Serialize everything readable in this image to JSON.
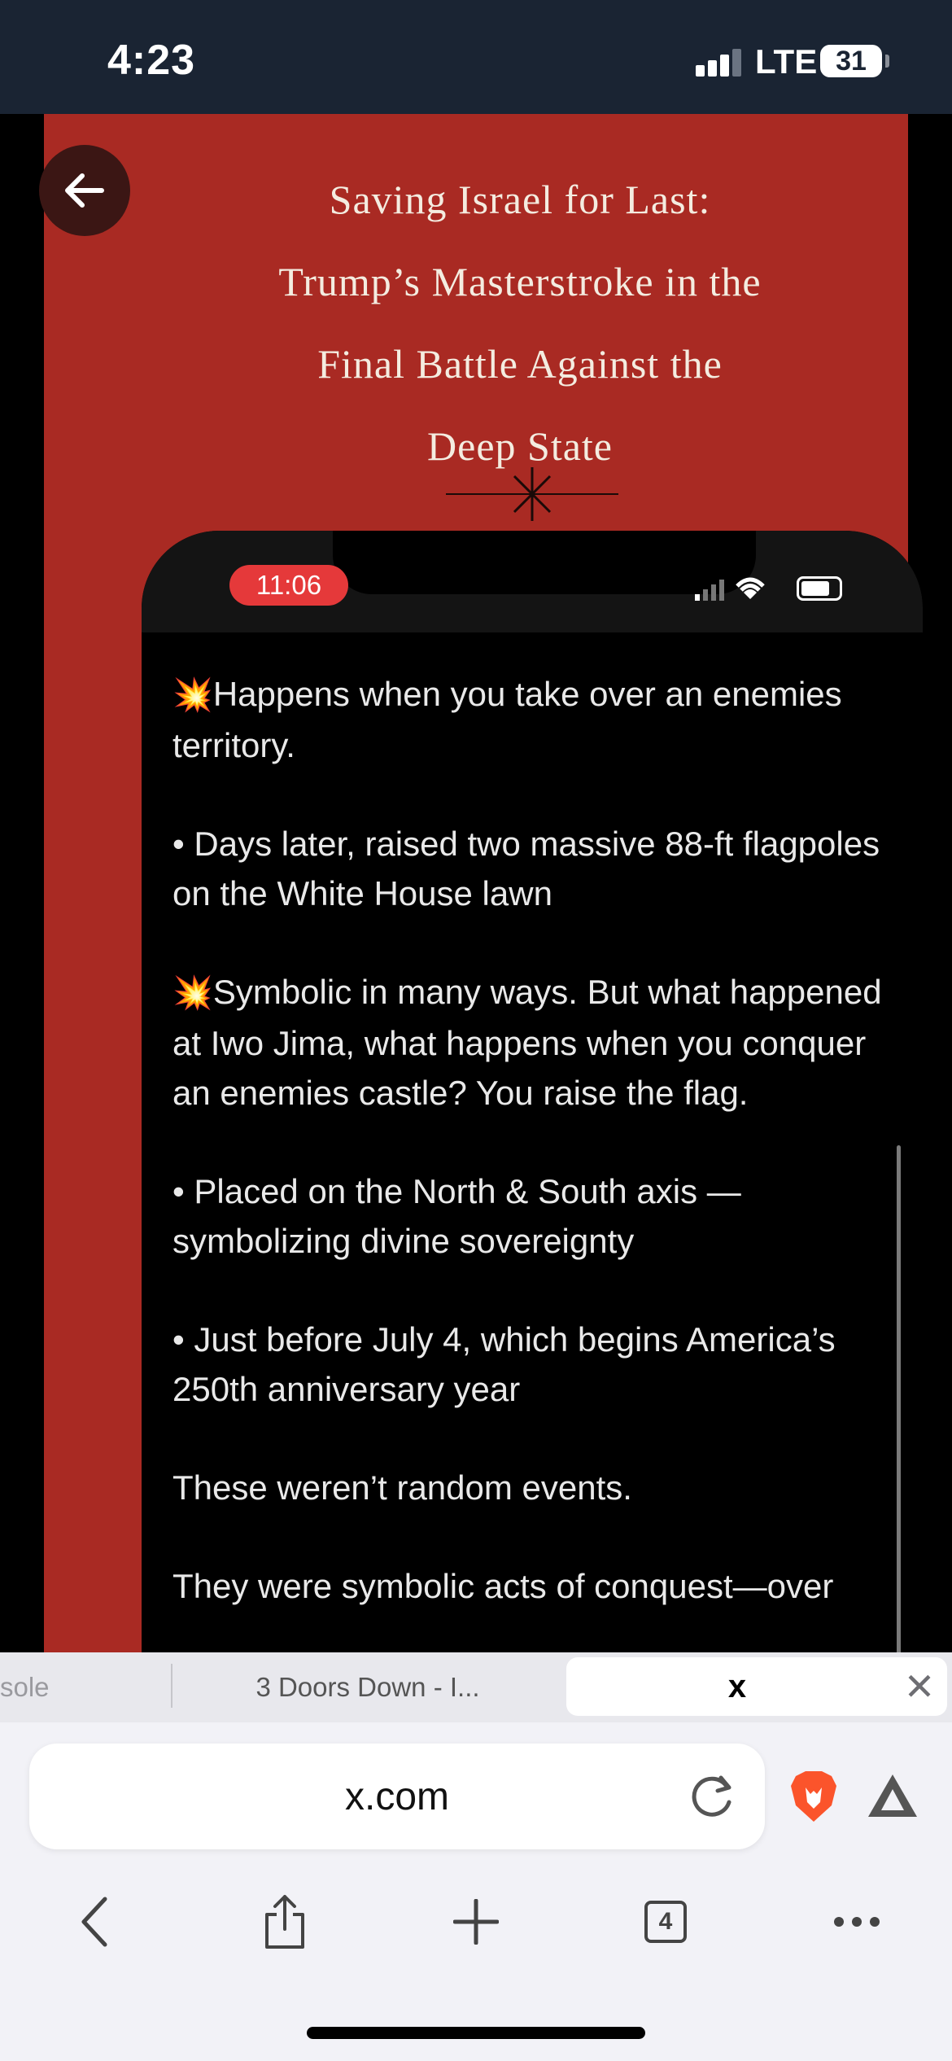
{
  "status_bar": {
    "time": "4:23",
    "network": "LTE",
    "battery": "31"
  },
  "article": {
    "title_lines": [
      "Saving Israel for Last:",
      "Trump’s Masterstroke in the",
      "Final Battle Against the",
      "Deep State"
    ]
  },
  "embedded_phone": {
    "time": "11:06",
    "paragraphs": [
      {
        "icon": "💥",
        "text": "Happens when you take over an enemies territory."
      },
      {
        "icon": "",
        "text": "• Days later, raised two massive 88-ft flagpoles on the White House lawn"
      },
      {
        "icon": "💥",
        "text": "Symbolic in many ways. But what happened at Iwo Jima, what happens when you conquer an enemies castle? You raise the flag."
      },
      {
        "icon": "",
        "text": "• Placed on the North & South axis — symbolizing divine sovereignty"
      },
      {
        "icon": "",
        "text": "• Just before July 4, which begins America’s 250th anniversary year"
      },
      {
        "icon": "",
        "text": "These weren’t random events."
      },
      {
        "icon": "",
        "text": "They were symbolic acts of conquest—over"
      }
    ]
  },
  "tabs": {
    "tab1": "sole",
    "tab2": "3 Doors Down - I...",
    "active": "x"
  },
  "browser": {
    "url": "x.com",
    "tab_count": "4"
  },
  "colors": {
    "panel_red": "#a92a23",
    "status_bar": "#1a2433",
    "phone_time_badge": "#e5393a"
  }
}
